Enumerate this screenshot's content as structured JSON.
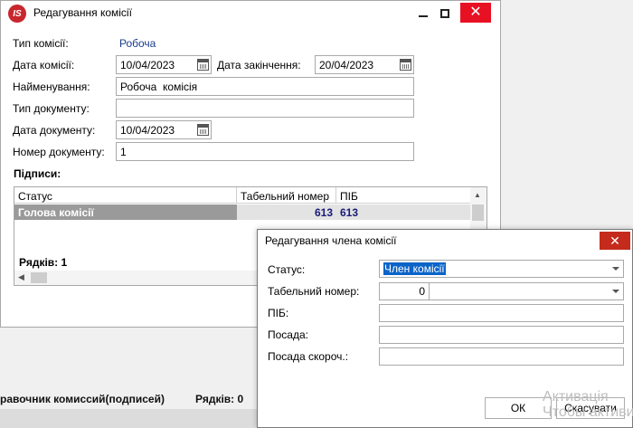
{
  "main_window": {
    "title": "Редагування комісії",
    "logo_text": "IS",
    "fields": {
      "commission_type_label": "Тип комісії:",
      "commission_type_value": "Робоча",
      "commission_date_label": "Дата комісії:",
      "commission_date_value": "10/04/2023",
      "end_date_label": "Дата закінчення:",
      "end_date_value": "20/04/2023",
      "name_label": "Найменування:",
      "name_value": "Робоча  комісія",
      "doc_type_label": "Тип документу:",
      "doc_type_value": "",
      "doc_date_label": "Дата документу:",
      "doc_date_value": "10/04/2023",
      "doc_number_label": "Номер документу:",
      "doc_number_value": "1"
    },
    "signatures": {
      "title": "Підписи:",
      "columns": [
        "Статус",
        "Табельний номер",
        "ПІБ"
      ],
      "rows": [
        {
          "status": "Голова комісії",
          "tab_number": "613",
          "pib": "613"
        }
      ],
      "rows_count": "Рядків: 1"
    }
  },
  "background": {
    "status_left": "равочник комиссий(подписей)",
    "status_right": "Рядків: 0"
  },
  "dialog": {
    "title": "Редагування члена комісії",
    "close_glyph": "✕",
    "status_label": "Статус:",
    "status_value": "Член комісії",
    "tab_number_label": "Табельний номер:",
    "tab_number_value": "0",
    "pib_label": "ПІБ:",
    "pib_value": "",
    "position_label": "Посада:",
    "position_value": "",
    "position_short_label": "Посада скороч.:",
    "position_short_value": "",
    "ok_label": "ОК",
    "cancel_label": "Скасувати"
  },
  "watermark": {
    "line1": "Активація",
    "line2": "Чтобы активи"
  },
  "colors": {
    "accent_blue": "#1a3c8f",
    "close_red": "#e81123",
    "selection_blue": "#0a64c8",
    "selected_row_gray": "#9a9a9a"
  },
  "icons": [
    "app-logo",
    "minimize-icon",
    "maximize-icon",
    "close-icon",
    "calendar-icon",
    "chevron-down-icon",
    "scroll-up-arrow",
    "scroll-left-arrow"
  ]
}
